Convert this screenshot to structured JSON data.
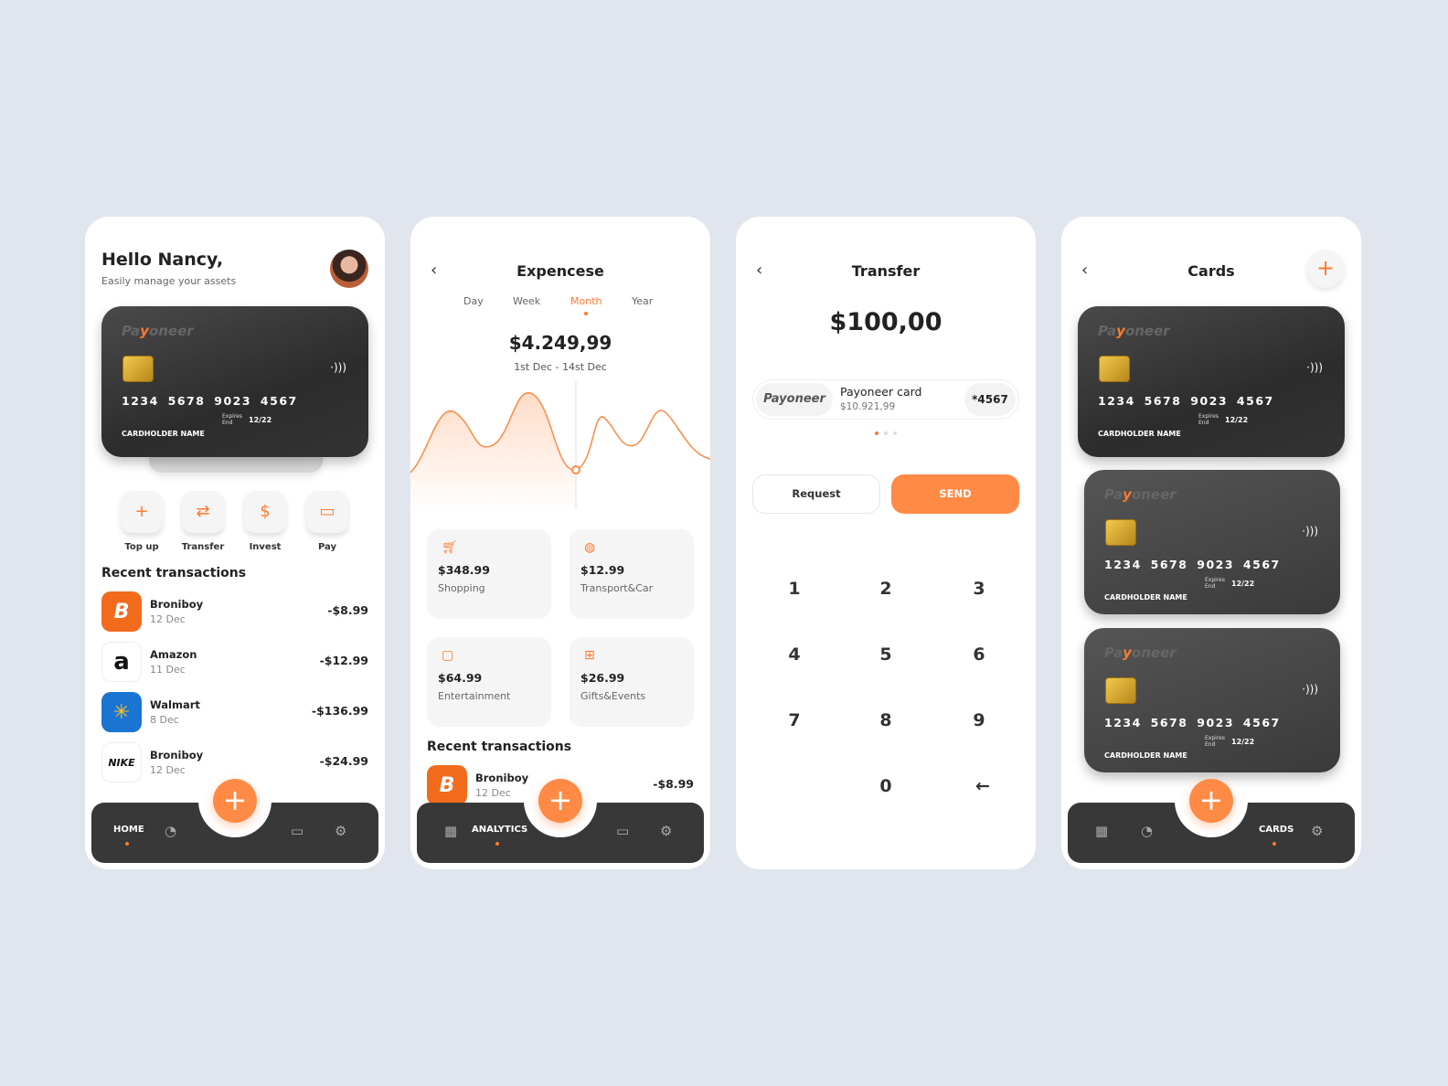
{
  "accent": "#ff8a45",
  "card": {
    "brand": "Payoneer",
    "number": "1234  5678  9023  4567",
    "expires_label_1": "Expires",
    "expires_label_2": "End",
    "expiry": "12/22",
    "holder": "CARDHOLDER NAME"
  },
  "home": {
    "greeting": "Hello Nancy,",
    "subtitle": "Easily manage your assets",
    "actions": [
      {
        "label": "Top up",
        "icon": "+"
      },
      {
        "label": "Transfer",
        "icon": "⇄"
      },
      {
        "label": "Invest",
        "icon": "$"
      },
      {
        "label": "Pay",
        "icon": "▭"
      }
    ],
    "recent_title": "Recent transactions",
    "transactions": [
      {
        "name": "Broniboy",
        "date": "12 Dec",
        "amount": "-$8.99",
        "logo": "B"
      },
      {
        "name": "Amazon",
        "date": "11 Dec",
        "amount": "-$12.99",
        "logo": "a"
      },
      {
        "name": "Walmart",
        "date": "8 Dec",
        "amount": "-$136.99",
        "logo": "✳"
      },
      {
        "name": "Broniboy",
        "date": "12 Dec",
        "amount": "-$24.99",
        "logo": "NIKE"
      }
    ],
    "nav_label": "HOME"
  },
  "analytics": {
    "title": "Expencese",
    "periods": [
      "Day",
      "Week",
      "Month",
      "Year"
    ],
    "active_period": "Month",
    "total": "$4.249,99",
    "range": "1st Dec - 14st Dec",
    "categories": [
      {
        "value": "$348.99",
        "label": "Shopping",
        "icon": "cart-icon"
      },
      {
        "value": "$12.99",
        "label": "Transport&Car",
        "icon": "ball-icon"
      },
      {
        "value": "$64.99",
        "label": "Entertainment",
        "icon": "tv-icon"
      },
      {
        "value": "$26.99",
        "label": "Gifts&Events",
        "icon": "gift-icon"
      }
    ],
    "recent_title": "Recent transactions",
    "transaction": {
      "name": "Broniboy",
      "date": "12 Dec",
      "amount": "-$8.99",
      "logo": "B"
    },
    "nav_label": "ANALYTICS"
  },
  "transfer": {
    "title": "Transfer",
    "amount": "$100,00",
    "card_brand": "Payoneer",
    "card_name": "Payoneer card",
    "card_balance": "$10.921,99",
    "card_last": "*4567",
    "request_label": "Request",
    "send_label": "SEND",
    "keys": [
      "1",
      "2",
      "3",
      "4",
      "5",
      "6",
      "7",
      "8",
      "9",
      "0",
      "←"
    ]
  },
  "cards": {
    "title": "Cards",
    "add": "+",
    "nav_label": "CARDS"
  }
}
